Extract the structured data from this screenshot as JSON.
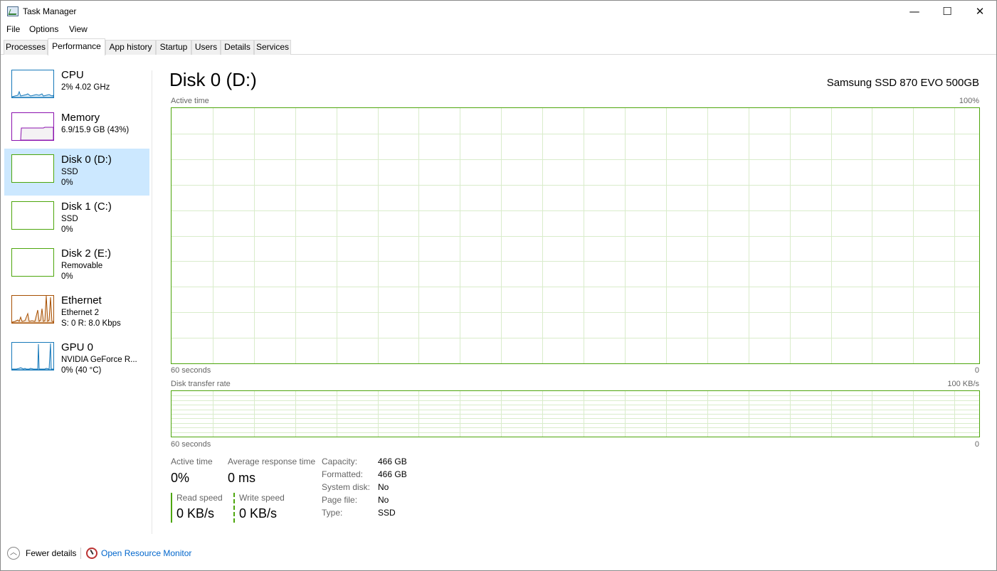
{
  "window": {
    "title": "Task Manager",
    "controls": {
      "minimize": "—",
      "maximize": "☐",
      "close": "✕"
    }
  },
  "menu": [
    "File",
    "Options",
    "View"
  ],
  "tabs": [
    "Processes",
    "Performance",
    "App history",
    "Startup",
    "Users",
    "Details",
    "Services"
  ],
  "active_tab": "Performance",
  "sidebar": {
    "items": [
      {
        "title": "CPU",
        "lines": [
          "2%  4.02 GHz"
        ],
        "color": "#1779ba"
      },
      {
        "title": "Memory",
        "lines": [
          "6.9/15.9 GB (43%)"
        ],
        "color": "#8b12ae"
      },
      {
        "title": "Disk 0 (D:)",
        "lines": [
          "SSD",
          "0%"
        ],
        "color": "#4da60c"
      },
      {
        "title": "Disk 1 (C:)",
        "lines": [
          "SSD",
          "0%"
        ],
        "color": "#4da60c"
      },
      {
        "title": "Disk 2 (E:)",
        "lines": [
          "Removable",
          "0%"
        ],
        "color": "#4da60c"
      },
      {
        "title": "Ethernet",
        "lines": [
          "Ethernet 2",
          "S: 0  R: 8.0 Kbps"
        ],
        "color": "#a74f01"
      },
      {
        "title": "GPU 0",
        "lines": [
          "NVIDIA GeForce R...",
          "0%  (40 °C)"
        ],
        "color": "#1779ba"
      }
    ],
    "selected_index": 2
  },
  "main": {
    "title": "Disk 0 (D:)",
    "device": "Samsung SSD 870 EVO 500GB",
    "active_graph": {
      "label": "Active time",
      "max_label": "100%",
      "time_label": "60 seconds",
      "min_label": "0"
    },
    "transfer_graph": {
      "label": "Disk transfer rate",
      "max_label": "100 KB/s",
      "time_label": "60 seconds",
      "min_label": "0"
    },
    "stats": {
      "active_time_label": "Active time",
      "active_time_value": "0%",
      "avg_response_label": "Average response time",
      "avg_response_value": "0 ms",
      "read_speed_label": "Read speed",
      "read_speed_value": "0 KB/s",
      "write_speed_label": "Write speed",
      "write_speed_value": "0 KB/s"
    },
    "properties": [
      {
        "label": "Capacity:",
        "value": "466 GB"
      },
      {
        "label": "Formatted:",
        "value": "466 GB"
      },
      {
        "label": "System disk:",
        "value": "No"
      },
      {
        "label": "Page file:",
        "value": "No"
      },
      {
        "label": "Type:",
        "value": "SSD"
      }
    ]
  },
  "footer": {
    "fewer_details": "Fewer details",
    "resource_monitor": "Open Resource Monitor"
  },
  "colors": {
    "disk_green": "#4da60c",
    "grid_green": "#d9eccb",
    "selection": "#cce8ff",
    "link": "#0066cc"
  }
}
